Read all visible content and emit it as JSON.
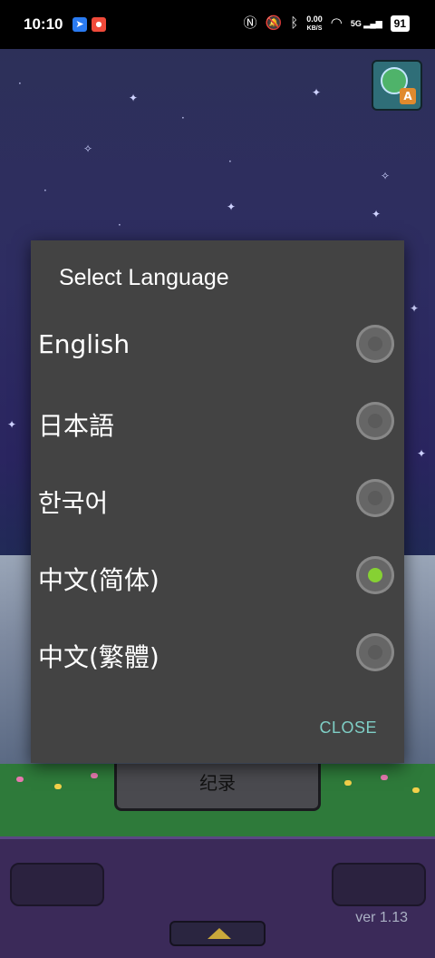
{
  "status_bar": {
    "time": "10:10",
    "network_speed_top": "0.00",
    "network_speed_unit": "KB/S",
    "signal_label": "5G",
    "battery": "91"
  },
  "dialog": {
    "title": "Select Language",
    "options": [
      {
        "label": "English",
        "selected": false
      },
      {
        "label": "日本語",
        "selected": false
      },
      {
        "label": "한국어",
        "selected": false
      },
      {
        "label": "中文(简体)",
        "selected": true
      },
      {
        "label": "中文(繁體)",
        "selected": false
      }
    ],
    "close_label": "CLOSE",
    "selected_color": "#86d133",
    "accent_color": "#7fcfc6"
  },
  "game": {
    "record_label": "纪录",
    "version": "ver 1.13"
  }
}
